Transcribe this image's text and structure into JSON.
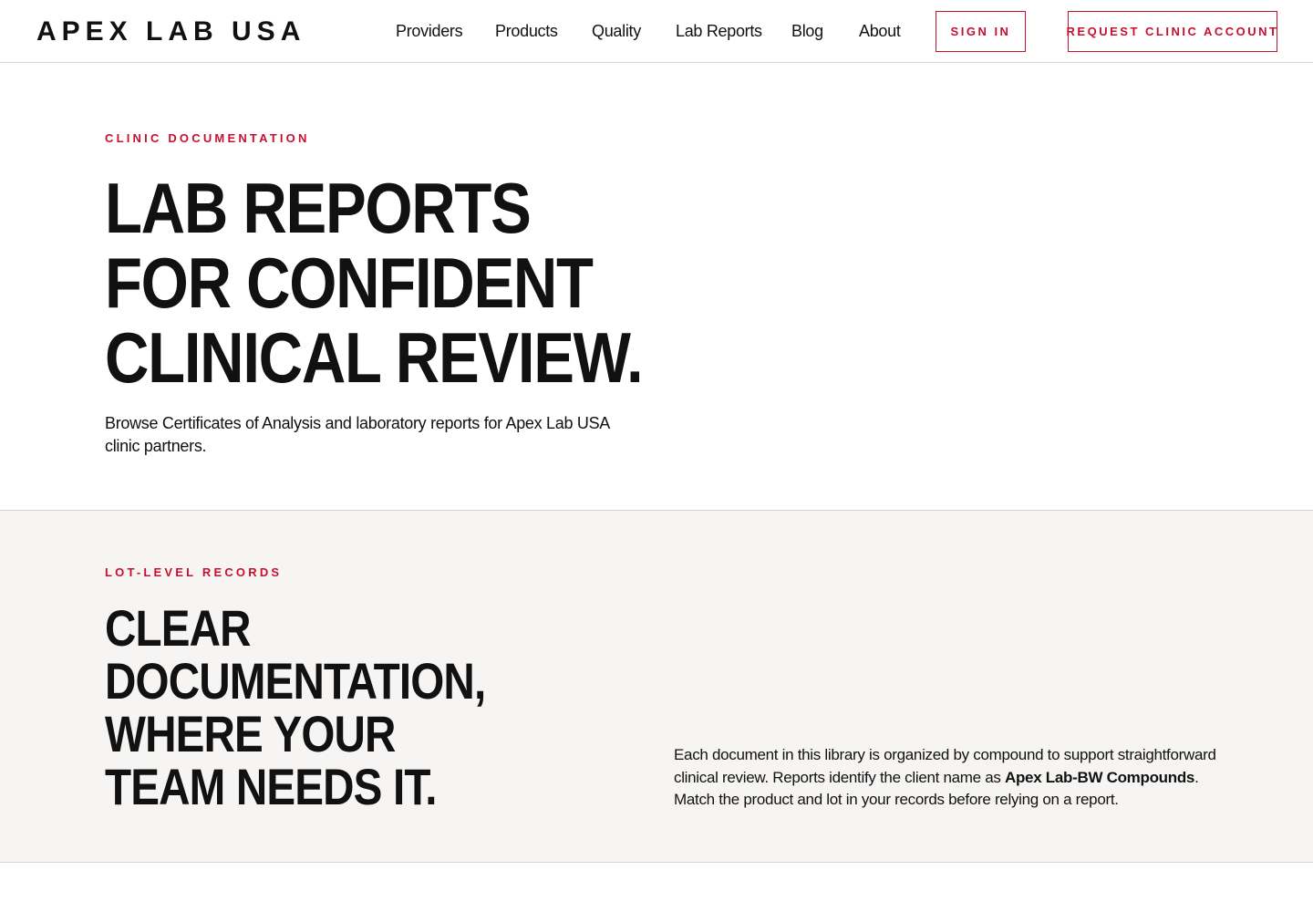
{
  "header": {
    "brand": "APEX LAB USA",
    "nav": [
      {
        "label": "Providers"
      },
      {
        "label": "Products"
      },
      {
        "label": "Quality"
      },
      {
        "label": "Lab Reports"
      },
      {
        "label": "Blog"
      },
      {
        "label": "About"
      }
    ],
    "sign_in_label": "SIGN IN",
    "request_account_label": "REQUEST CLINIC ACCOUNT"
  },
  "hero": {
    "eyebrow": "CLINIC DOCUMENTATION",
    "title_lines": [
      "LAB REPORTS",
      "FOR CONFIDENT",
      "CLINICAL REVIEW."
    ],
    "subtitle": "Browse Certificates of Analysis and laboratory reports for Apex Lab USA clinic partners."
  },
  "records": {
    "eyebrow": "LOT-LEVEL RECORDS",
    "title_lines": [
      "CLEAR",
      "DOCUMENTATION,",
      "WHERE YOUR",
      "TEAM NEEDS IT."
    ],
    "body_before": "Each document in this library is organized by compound to support straightforward clinical review. Reports identify the client name as ",
    "body_bold": "Apex Lab-BW Compounds",
    "body_after": ". Match the product and lot in your records before relying on a report."
  },
  "colors": {
    "accent": "#c8102e",
    "text": "#111111",
    "section_bg": "#f6f5f3"
  }
}
